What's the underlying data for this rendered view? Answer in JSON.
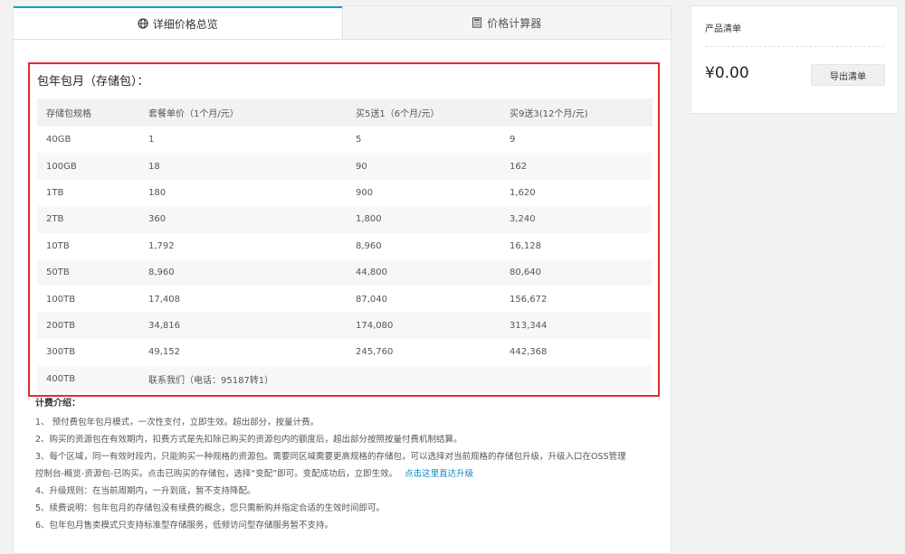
{
  "tabs": [
    {
      "label": "详细价格总览",
      "icon": "globe-icon",
      "active": true
    },
    {
      "label": "价格计算器",
      "icon": "calculator-icon",
      "active": false
    }
  ],
  "section": {
    "title": "包年包月（存储包）："
  },
  "table": {
    "headers": [
      "存储包规格",
      "套餐单价（1个月/元）",
      "买5送1（6个月/元）",
      "买9送3(12个月/元)"
    ],
    "rows": [
      [
        "40GB",
        "1",
        "5",
        "9"
      ],
      [
        "100GB",
        "18",
        "90",
        "162"
      ],
      [
        "1TB",
        "180",
        "900",
        "1,620"
      ],
      [
        "2TB",
        "360",
        "1,800",
        "3,240"
      ],
      [
        "10TB",
        "1,792",
        "8,960",
        "16,128"
      ],
      [
        "50TB",
        "8,960",
        "44,800",
        "80,640"
      ],
      [
        "100TB",
        "17,408",
        "87,040",
        "156,672"
      ],
      [
        "200TB",
        "34,816",
        "174,080",
        "313,344"
      ],
      [
        "300TB",
        "49,152",
        "245,760",
        "442,368"
      ],
      [
        "400TB",
        "联系我们（电话：95187转1）",
        "",
        ""
      ]
    ]
  },
  "notes": {
    "title": "计费介绍：",
    "items": [
      "1、 预付费包年包月模式，一次性支付，立即生效。超出部分，按量计费。",
      "2、购买的资源包在有效期内，扣费方式是先扣除已购买的资源包内的额度后，超出部分按照按量付费机制结算。",
      "3、每个区域，同一有效时段内，只能购买一种规格的资源包。需要同区域需要更高规格的存储包，可以选择对当前规格的存储包升级，升级入口在OSS管理",
      "控制台-概览-资源包-已购买。点击已购买的存储包，选择“变配”即可。变配成功后，立即生效。",
      "4、升级规则：在当前周期内，一升到底，暂不支持降配。",
      "5、续费说明：包年包月的存储包没有续费的概念，您只需新购并指定合适的生效时间即可。",
      "6、包年包月售卖模式只支持标准型存储服务，低频访问型存储服务暂不支持。"
    ],
    "upgrade_link": "点击这里直达升级"
  },
  "side": {
    "title": "产品清单",
    "total": "¥0.00",
    "export_label": "导出清单"
  },
  "colors": {
    "accent": "#00a2ca",
    "highlight_border": "#e02c2c",
    "link": "#0a88c4"
  }
}
